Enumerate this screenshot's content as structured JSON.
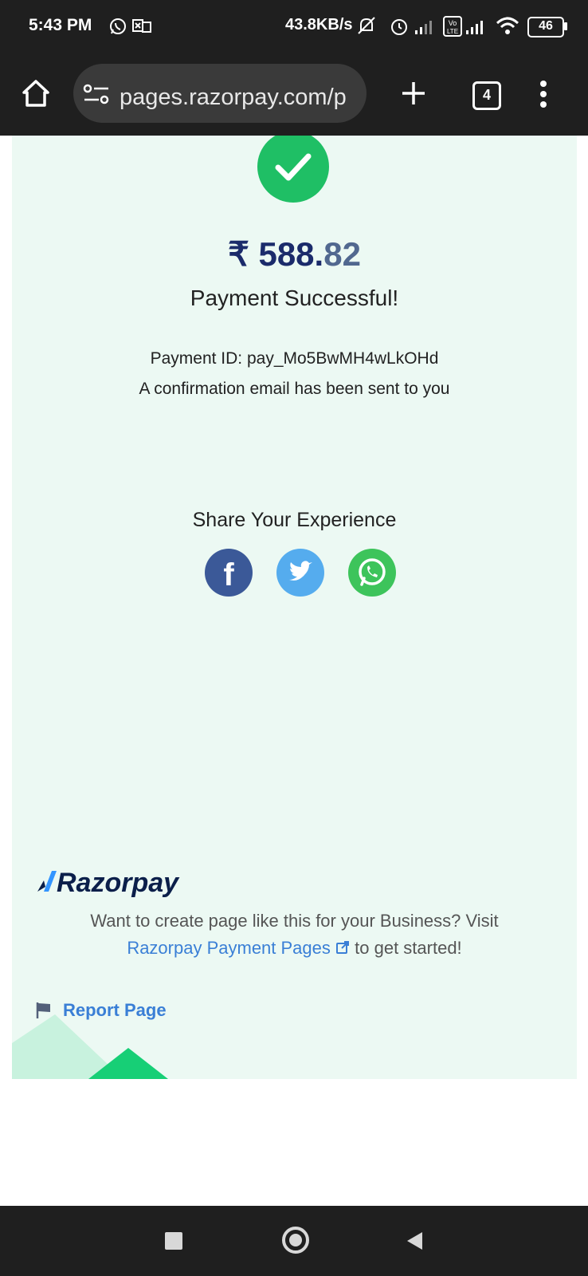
{
  "status_bar": {
    "time": "5:43 PM",
    "net_speed": "43.8KB/s",
    "battery": "46",
    "icons": [
      "whatsapp-icon",
      "notification-icon",
      "mute-icon",
      "alarm-icon",
      "signal-icon",
      "volte-icon",
      "signal-icon",
      "wifi-icon",
      "battery-icon"
    ]
  },
  "browser": {
    "url": "pages.razorpay.com/p",
    "tab_count": "4",
    "icons": [
      "home-icon",
      "site-settings-icon",
      "new-tab-icon",
      "tabs-icon",
      "more-icon"
    ]
  },
  "payment": {
    "currency": "₹",
    "amount_main": "588.",
    "amount_decimal": "82",
    "title": "Payment Successful!",
    "payment_id": "Payment ID: pay_Mo5BwMH4wLkOHd",
    "email_note": "A confirmation email has been sent to you"
  },
  "share": {
    "heading": "Share Your Experience",
    "networks": [
      "facebook-icon",
      "twitter-icon",
      "whatsapp-icon"
    ],
    "colors": {
      "facebook": "#3b5998",
      "twitter": "#55acee",
      "whatsapp": "#3dc45b"
    }
  },
  "footer": {
    "brand": "Razorpay",
    "promo_line1": "Want to create page like this for your Business? Visit",
    "promo_link": "Razorpay Payment Pages",
    "promo_line2_suffix": "to get started!",
    "report": "Report Page"
  },
  "colors": {
    "success": "#1fbf65",
    "background": "#ecf9f3",
    "amount": "#1b2b6b",
    "link": "#3a7fd6"
  },
  "nav": {
    "icons": [
      "recents-icon",
      "home-button-icon",
      "back-icon"
    ]
  }
}
